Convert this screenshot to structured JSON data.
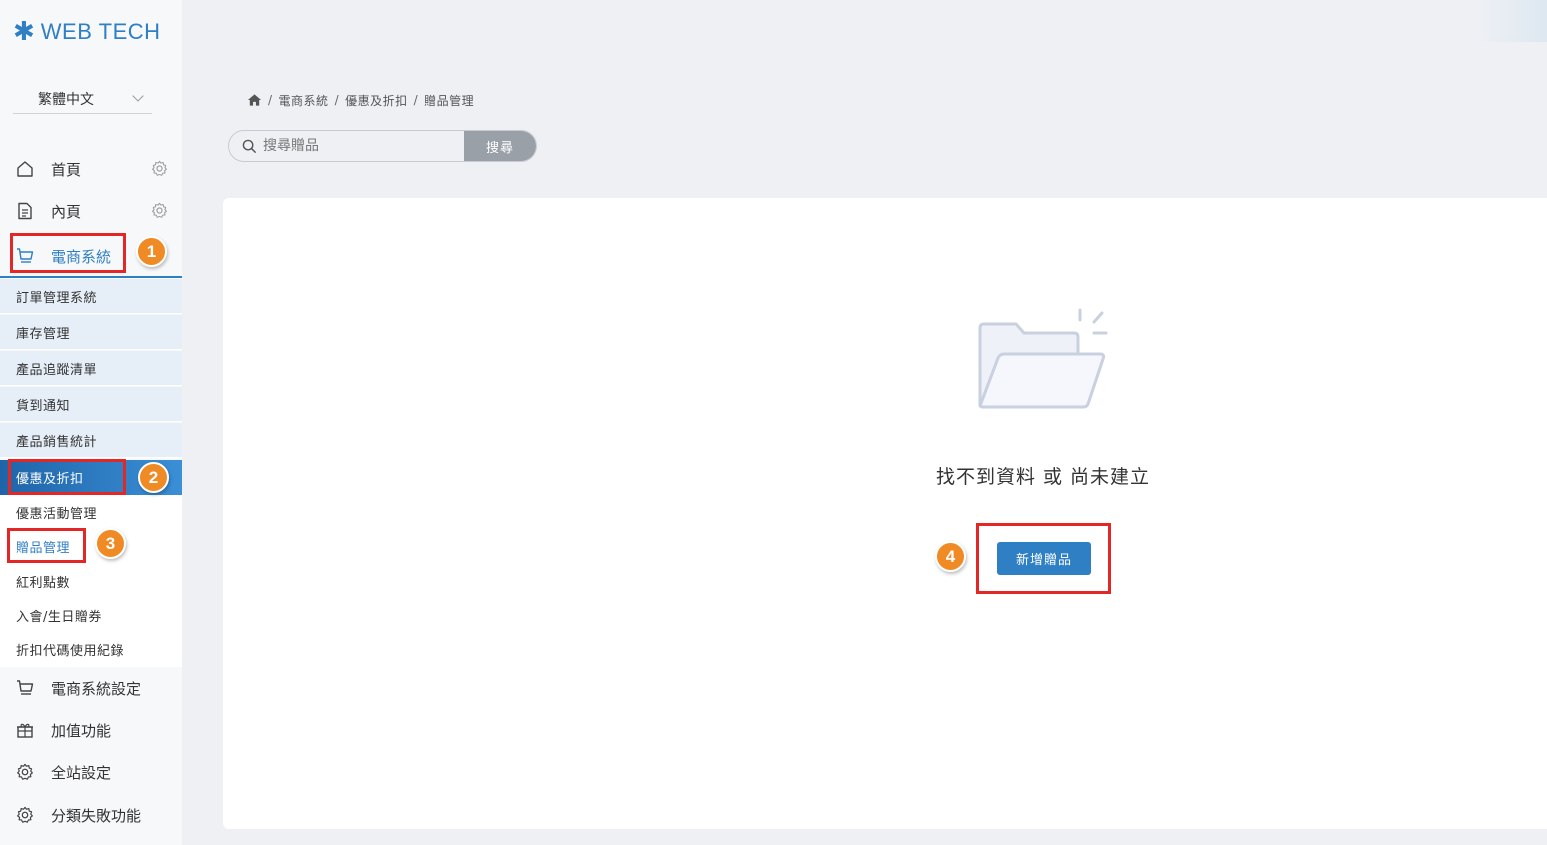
{
  "brand": {
    "logo_text": "WEB TECH"
  },
  "language": {
    "selected": "繁體中文"
  },
  "nav": {
    "home": "首頁",
    "inner": "內頁",
    "ecommerce": "電商系統",
    "ecommerce_settings": "電商系統設定",
    "addons": "加值功能",
    "site_settings": "全站設定",
    "category_fail": "分類失敗功能"
  },
  "submenu": [
    "訂單管理系統",
    "庫存管理",
    "產品追蹤清單",
    "貨到通知",
    "產品銷售統計",
    "優惠及折扣",
    "優惠活動管理",
    "贈品管理",
    "紅利點數",
    "入會/生日贈券",
    "折扣代碼使用紀錄"
  ],
  "breadcrumb": [
    "電商系統",
    "優惠及折扣",
    "贈品管理"
  ],
  "search": {
    "placeholder": "搜尋贈品",
    "button": "搜尋"
  },
  "empty": {
    "message": "找不到資料 或 尚未建立",
    "add_button": "新增贈品"
  },
  "annotations": [
    "1",
    "2",
    "3",
    "4"
  ],
  "colors": {
    "accent": "#2f7fc4",
    "highlight_box": "#e32626",
    "badge": "#f08a24"
  }
}
